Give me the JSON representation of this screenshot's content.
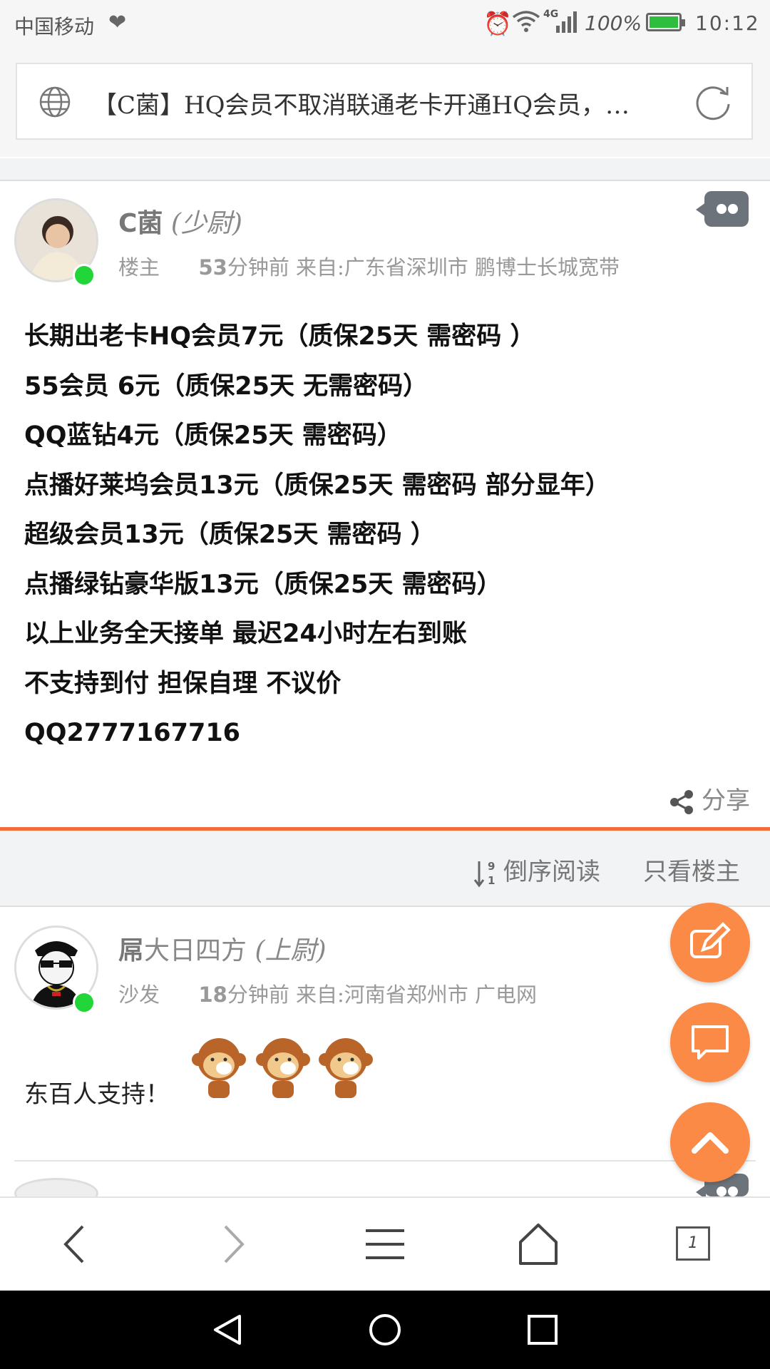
{
  "status_bar": {
    "carrier": "中国移动",
    "network": "4G",
    "battery_percent": "100%",
    "time": "10:12"
  },
  "address_bar": {
    "title": "【C菌】HQ会员不取消联通老卡开通HQ会员，…",
    "icons": {
      "left": "globe-icon",
      "right": "refresh-icon"
    }
  },
  "main_post": {
    "author_name": "C菌",
    "author_rank": "(少尉)",
    "floor": "楼主",
    "minutes": "53",
    "time_suffix": "分钟前 来自:广东省深圳市 鹏博士长城宽带",
    "body_lines": [
      "长期出老卡HQ会员7元（质保25天 需密码 ）",
      "55会员 6元（质保25天 无需密码）",
      "QQ蓝钻4元（质保25天 需密码）",
      "点播好莱坞会员13元（质保25天 需密码 部分显年）",
      "超级会员13元（质保25天 需密码 ）",
      "点播绿钻豪华版13元（质保25天 需密码）",
      "以上业务全天接单 最迟24小时左右到账",
      "不支持到付 担保自理 不议价",
      "QQ2777167716"
    ],
    "share_label": "分享"
  },
  "sort_bar": {
    "reverse_label": "倒序阅读",
    "only_owner_label": "只看楼主"
  },
  "reply": {
    "author_name_bold": "屌",
    "author_name_rest": "大日四方",
    "author_rank": "(上尉)",
    "floor": "沙发",
    "minutes": "18",
    "time_suffix": "分钟前 来自:河南省郑州市 广电网",
    "text": "东百人支持！"
  },
  "colors": {
    "accent": "#f26b3a",
    "fab": "#fb8a47",
    "online": "#22d63a",
    "bubble": "#6d737a"
  },
  "toolbar": {
    "tab_count": "1"
  }
}
